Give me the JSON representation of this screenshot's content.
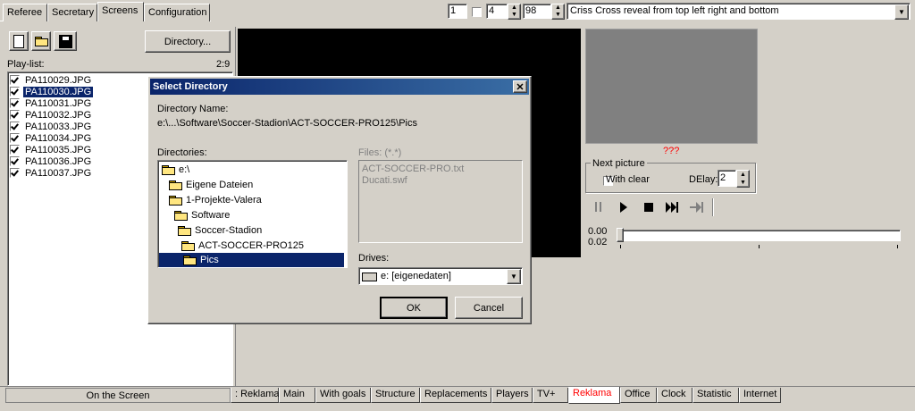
{
  "top_tabs": [
    "Referee",
    "Secretary",
    "Screens",
    "Configuration"
  ],
  "top_controls": {
    "start": "1",
    "count": "4",
    "percent": "98",
    "transition": "Criss Cross reveal from top left right and bottom"
  },
  "left_panel": {
    "directory_button": "Directory...",
    "playlist_label": "Play-list:",
    "playlist_counter": "2:9",
    "items": [
      "PA110029.JPG",
      "PA110030.JPG",
      "PA110031.JPG",
      "PA110032.JPG",
      "PA110033.JPG",
      "PA110034.JPG",
      "PA110035.JPG",
      "PA110036.JPG",
      "PA110037.JPG"
    ]
  },
  "dialog": {
    "title": "Select Directory",
    "dir_name_label": "Directory Name:",
    "dir_name_value": "e:\\...\\Software\\Soccer-Stadion\\ACT-SOCCER-PRO125\\Pics",
    "directories_label": "Directories:",
    "tree": [
      "e:\\",
      "Eigene Dateien",
      "1-Projekte-Valera",
      "Software",
      "Soccer-Stadion",
      "ACT-SOCCER-PRO125",
      "Pics"
    ],
    "files_label": "Files: (*.*)",
    "files": [
      "ACT-SOCCER-PRO.txt",
      "Ducati.swf"
    ],
    "drives_label": "Drives:",
    "drive_value": "e: [eigenedaten]",
    "ok": "OK",
    "cancel": "Cancel"
  },
  "right_panel": {
    "preview_caption": "???",
    "next_picture_label": "Next picture",
    "with_clear": "With clear",
    "delay_label": "DElay:",
    "delay_value": "2",
    "time_current": "0.00",
    "time_total": "0.02"
  },
  "bottom": {
    "status": "On the Screen",
    "tabs": [
      ": Reklama",
      "Main",
      "With goals",
      "Structure",
      "Replacements",
      "Players",
      "TV+",
      "Reklama",
      "Office",
      "Clock",
      "Statistic",
      "Internet"
    ],
    "active_tab": "Reklama"
  },
  "colors": {
    "face": "#d4d0c8",
    "selection": "#0a246a",
    "caption_red": "#ff0000"
  }
}
